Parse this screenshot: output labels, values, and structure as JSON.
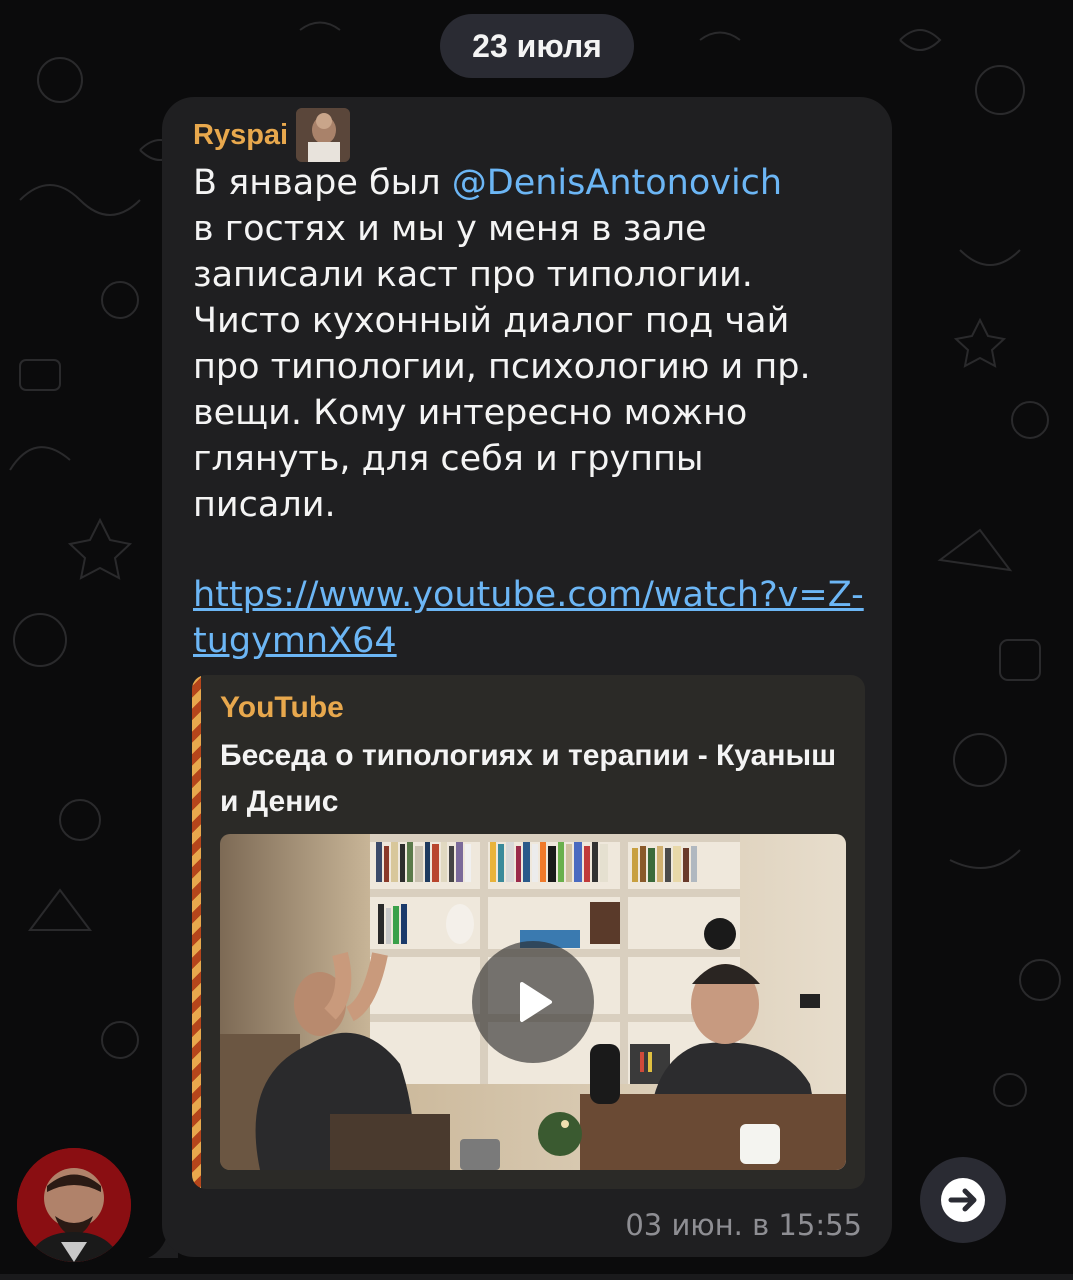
{
  "date_separator": "23 июля",
  "message": {
    "sender_name": "Ryspai",
    "text_before_mention": "В январе был ",
    "mention": "@DenisAntonovich",
    "text_after_mention": "\nв гостях и мы у меня в зале\nзаписали каст про типологии.\nЧисто кухонный диалог под чай\nпро типологии, психологию и пр.\nвещи. Кому интересно можно\nглянуть, для себя и группы\nписали.",
    "link": "https://www.youtube.com/watch?v=Z-tugymnX64",
    "timestamp": "03 июн. в 15:55"
  },
  "link_preview": {
    "site_name": "YouTube",
    "title": "Беседа о типологиях и терапии - Куаныш и Денис",
    "thumbnail_icon": "video-thumbnail",
    "play_icon": "play-icon"
  },
  "colors": {
    "background": "#0b0b0c",
    "bubble": "#1f1f21",
    "sender": "#e8a84d",
    "link": "#6cb6f5",
    "preview_accent": "#e8a84d"
  },
  "icons": {
    "share": "share-arrow-icon",
    "avatar": "user-avatar"
  }
}
